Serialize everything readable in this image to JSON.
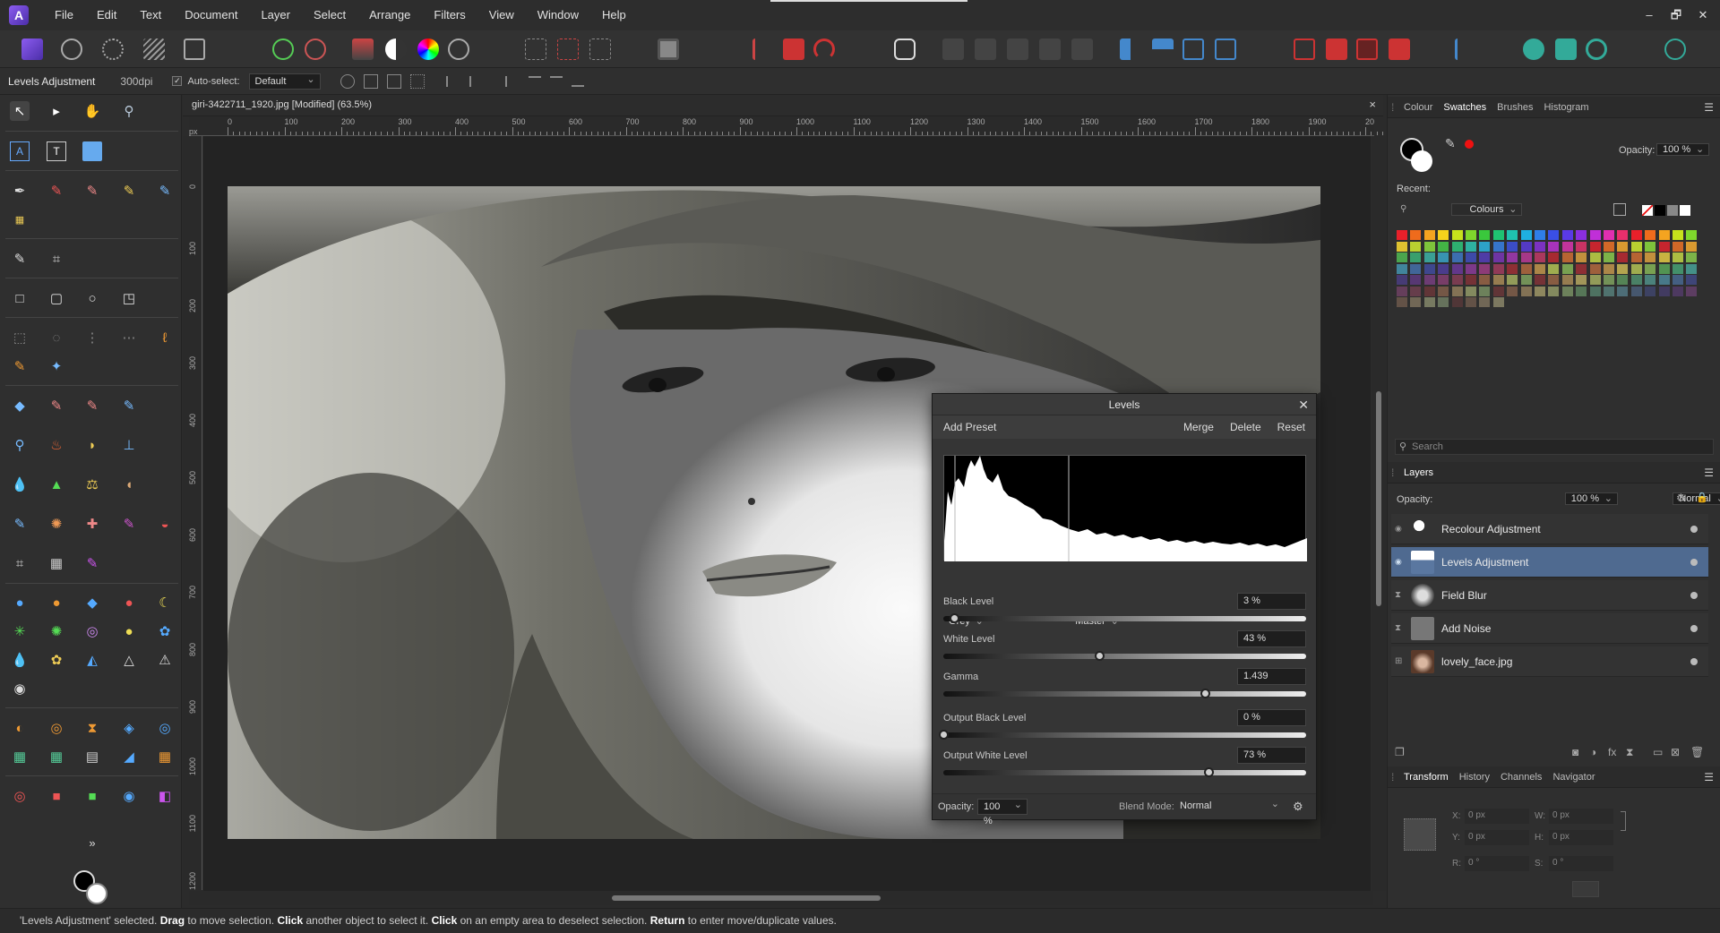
{
  "menubar": {
    "items": [
      "File",
      "Edit",
      "Text",
      "Document",
      "Layer",
      "Select",
      "Arrange",
      "Filters",
      "View",
      "Window",
      "Help"
    ],
    "window_controls": [
      "–",
      "🗗",
      "✕"
    ]
  },
  "context": {
    "layer_name": "Levels Adjustment",
    "dpi": "300dpi",
    "auto_select_label": "Auto-select:",
    "auto_select_value": "Default"
  },
  "document": {
    "tab_title": "giri-3422711_1920.jpg [Modified] (63.5%)",
    "ruler_unit": "px",
    "ruler_top_ticks": [
      "0",
      "100",
      "200",
      "300",
      "400",
      "500",
      "600",
      "700",
      "800",
      "900",
      "1000",
      "1100",
      "1200",
      "1300",
      "1400",
      "1500",
      "1600",
      "1700",
      "1800",
      "1900",
      "20"
    ],
    "ruler_left_ticks": [
      "0",
      "100",
      "200",
      "300",
      "400",
      "500",
      "600",
      "700",
      "800",
      "900",
      "1000",
      "1100",
      "1200"
    ]
  },
  "levels": {
    "title": "Levels",
    "add_preset": "Add Preset",
    "merge": "Merge",
    "delete": "Delete",
    "reset": "Reset",
    "channel_mode": "Grey",
    "channel": "Master",
    "black_level_label": "Black Level",
    "black_level": "3 %",
    "black_level_fraction": 0.03,
    "white_level_label": "White Level",
    "white_level": "43 %",
    "white_level_fraction": 0.43,
    "gamma_label": "Gamma",
    "gamma": "1.439",
    "gamma_fraction": 0.72,
    "out_black_label": "Output Black Level",
    "out_black": "0 %",
    "out_black_fraction": 0.0,
    "out_white_label": "Output White Level",
    "out_white": "73 %",
    "out_white_fraction": 0.73,
    "opacity_label": "Opacity:",
    "opacity": "100 %",
    "blend_label": "Blend Mode:",
    "blend": "Normal"
  },
  "colour_panel": {
    "tabs": [
      "Colour",
      "Swatches",
      "Brushes",
      "Histogram"
    ],
    "active_tab": "Swatches",
    "opacity_label": "Opacity:",
    "opacity": "100 %",
    "recent_label": "Recent:",
    "palette": "Colours",
    "search_placeholder": "Search"
  },
  "layers_panel": {
    "title": "Layers",
    "opacity_label": "Opacity:",
    "opacity": "100 %",
    "blend": "Normal",
    "layers": [
      {
        "name": "Recolour Adjustment",
        "selected": false
      },
      {
        "name": "Levels Adjustment",
        "selected": true
      },
      {
        "name": "Field Blur",
        "selected": false
      },
      {
        "name": "Add Noise",
        "selected": false
      },
      {
        "name": "lovely_face.jpg",
        "selected": false
      }
    ]
  },
  "transform_panel": {
    "tabs": [
      "Transform",
      "History",
      "Channels",
      "Navigator"
    ],
    "active_tab": "Transform",
    "x_label": "X:",
    "x": "0 px",
    "y_label": "Y:",
    "y": "0 px",
    "w_label": "W:",
    "w": "0 px",
    "h_label": "H:",
    "h": "0 px",
    "r_label": "R:",
    "r": "0 °",
    "s_label": "S:",
    "s": "0 °"
  },
  "status": {
    "quoted": "'Levels Adjustment' selected.",
    "drag": "Drag",
    "t1": "to move selection.",
    "click": "Click",
    "t2": "another object to select it.",
    "click2": "Click",
    "t3": "on an empty area to deselect selection.",
    "ret": "Return",
    "t4": "to enter move/duplicate values."
  },
  "colors": {
    "accent": "#4f6a90",
    "brand": "#7b4fe0"
  }
}
